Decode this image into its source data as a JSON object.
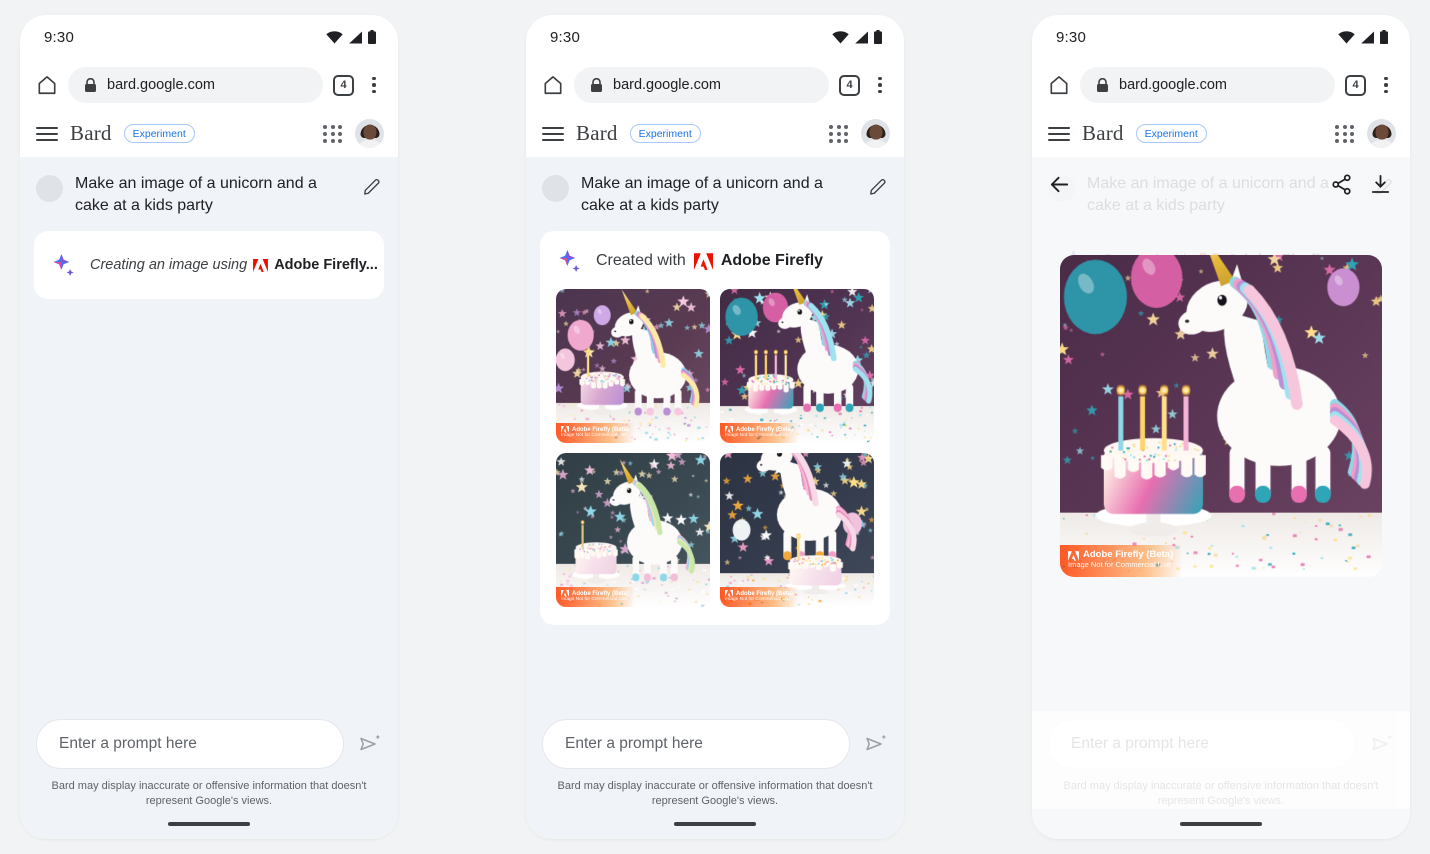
{
  "status_bar": {
    "time": "9:30",
    "icons": [
      "wifi-icon",
      "signal-icon",
      "battery-icon"
    ]
  },
  "browser": {
    "url": "bard.google.com",
    "lock_icon": "lock-icon",
    "home_icon": "home-icon",
    "tab_count": "4",
    "menu_icon": "overflow-menu-icon"
  },
  "app_bar": {
    "menu_icon": "hamburger-icon",
    "brand": "Bard",
    "badge": "Experiment",
    "apps_icon": "google-apps-grid-icon",
    "avatar": "user-avatar"
  },
  "conversation": {
    "user_prompt": "Make an image of a unicorn and a cake at a kids party",
    "edit_icon": "pencil-edit-icon",
    "loading_label": "Creating an image using",
    "loading_brand": "Adobe Firefly...",
    "created_label": "Created with",
    "created_brand": "Adobe Firefly",
    "sparkle_icon": "bard-sparkle-icon",
    "adobe_icon": "adobe-logo-icon"
  },
  "watermark": {
    "line1": "Adobe Firefly (Beta)",
    "line2": "Image Not for Commercial Use"
  },
  "composer": {
    "placeholder": "Enter a prompt here",
    "send_icon": "send-sparkle-icon",
    "disclaimer": "Bard may display inaccurate or offensive information that doesn't represent Google's views."
  },
  "overlay": {
    "back_icon": "back-arrow-icon",
    "share_icon": "share-icon",
    "download_icon": "download-icon"
  },
  "panels": [
    {
      "id": "panel-loading",
      "state": "generating"
    },
    {
      "id": "panel-results",
      "state": "four-results"
    },
    {
      "id": "panel-fullscreen",
      "state": "image-expanded"
    }
  ],
  "colors": {
    "page_bg": "#f1f3f4",
    "panel_bg": "#ffffff",
    "convo_bg": "#f0f3f7",
    "accent_blue": "#1a73e8",
    "badge_border": "#a8c7fa",
    "adobe_red": "#eb1000",
    "text_primary": "#202124",
    "text_secondary": "#5f6368"
  },
  "images": [
    {
      "name": "unicorn-cake-1",
      "bg": "#4a3348",
      "palette": [
        "#f6c9e0",
        "#b98fd6",
        "#ffe9a8"
      ]
    },
    {
      "name": "unicorn-cake-2",
      "bg": "#3f2b42",
      "palette": [
        "#2fa6b8",
        "#e86fb0",
        "#ffffff"
      ]
    },
    {
      "name": "unicorn-cake-3",
      "bg": "#2f3b42",
      "palette": [
        "#f3bfd8",
        "#8fd8e8",
        "#f7e6b8"
      ]
    },
    {
      "name": "unicorn-cake-4",
      "bg": "#2b3240",
      "palette": [
        "#f29ec8",
        "#f6a93b",
        "#ffffff"
      ]
    },
    {
      "name": "unicorn-cake-hero",
      "bg": "#4a2c47",
      "palette": [
        "#2fa6b8",
        "#e86fb0",
        "#f7d9a0"
      ]
    }
  ]
}
